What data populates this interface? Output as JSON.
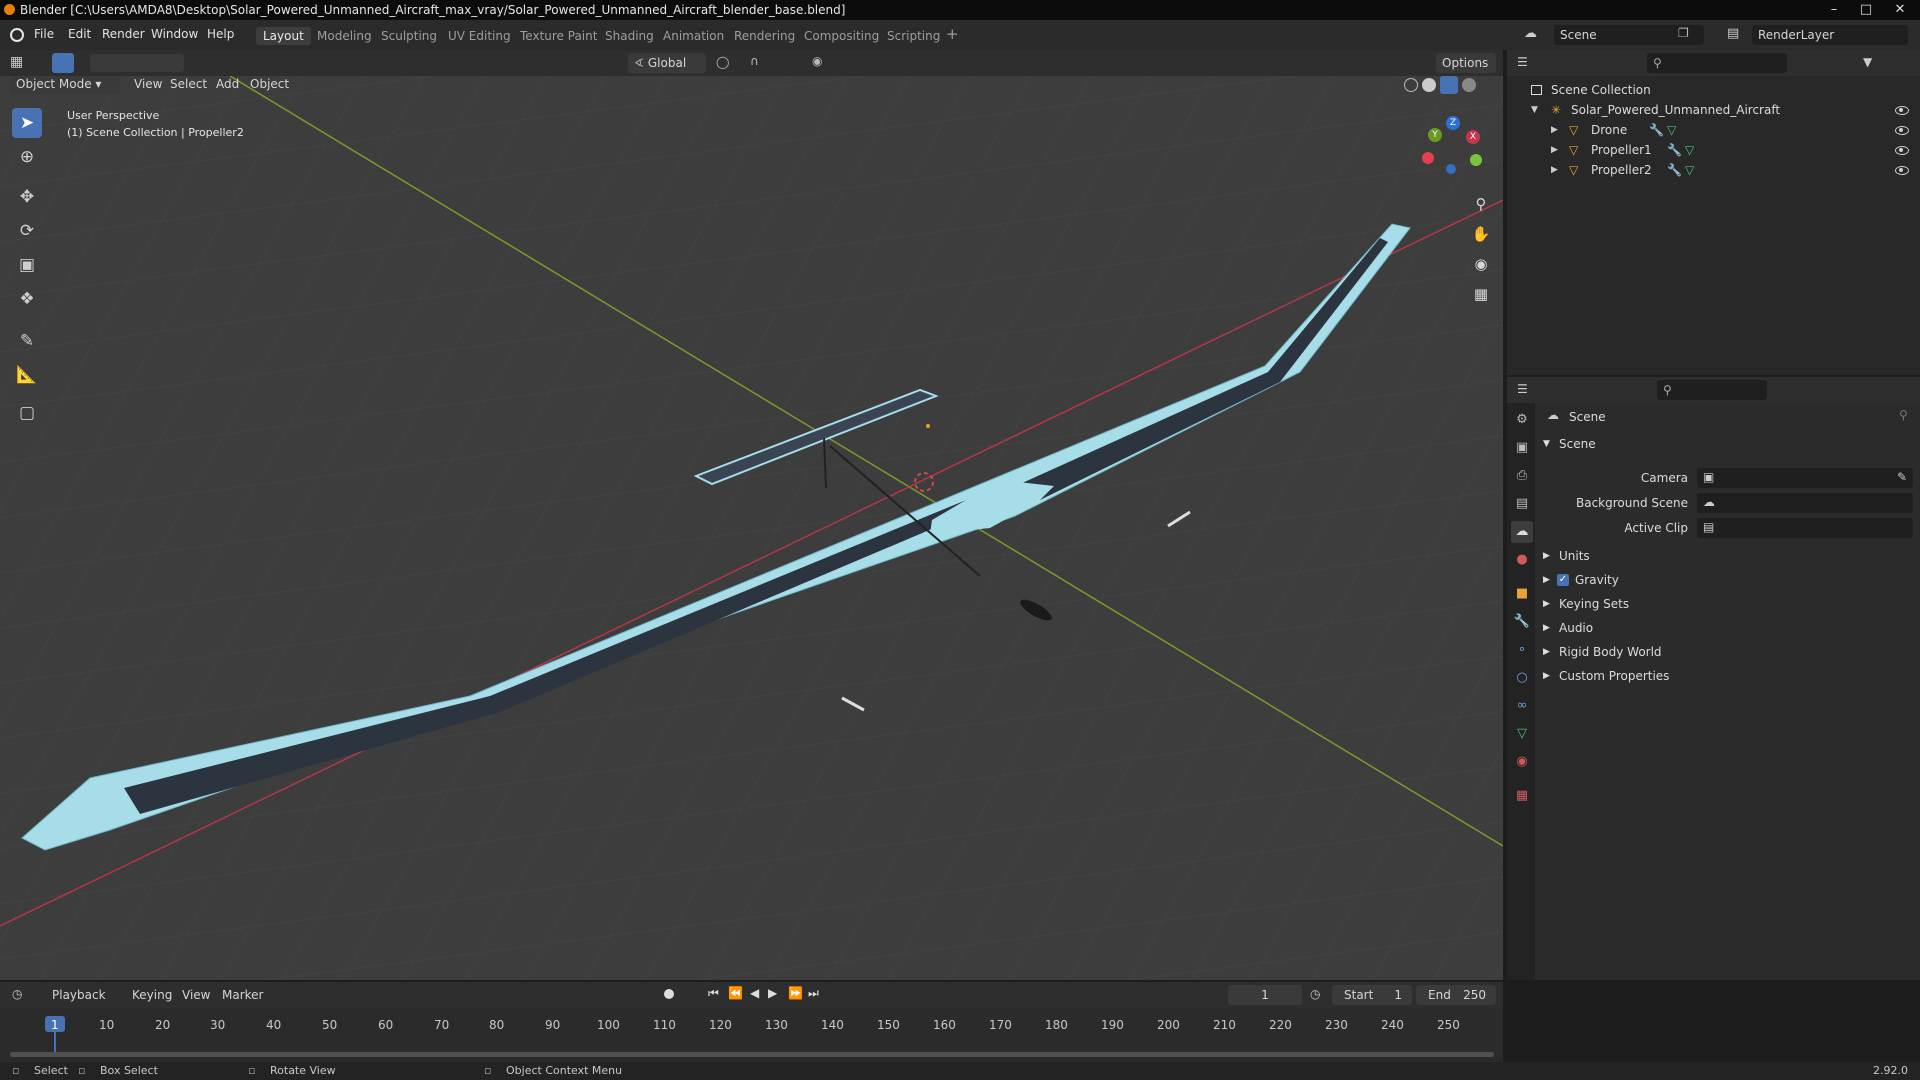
{
  "window": {
    "title": "Blender [C:\\Users\\AMDA8\\Desktop\\Solar_Powered_Unmanned_Aircraft_max_vray/Solar_Powered_Unmanned_Aircraft_blender_base.blend]"
  },
  "menubar": {
    "items": [
      "File",
      "Edit",
      "Render",
      "Window",
      "Help"
    ],
    "workspaces": [
      "Layout",
      "Modeling",
      "Sculpting",
      "UV Editing",
      "Texture Paint",
      "Shading",
      "Animation",
      "Rendering",
      "Compositing",
      "Scripting"
    ],
    "active_workspace": "Layout",
    "scene_name": "Scene",
    "view_layer": "RenderLayer"
  },
  "viewport_header": {
    "mode": "Object Mode",
    "menus": [
      "View",
      "Select",
      "Add",
      "Object"
    ],
    "transform_orientation": "Global",
    "options_label": "Options"
  },
  "viewport": {
    "perspective_label": "User Perspective",
    "collection_label": "(1) Scene Collection | Propeller2",
    "gizmo_axes": [
      "X",
      "Y",
      "Z"
    ]
  },
  "outliner": {
    "root": "Scene Collection",
    "collection": "Solar_Powered_Unmanned_Aircraft",
    "objects": [
      "Drone",
      "Propeller1",
      "Propeller2"
    ]
  },
  "properties": {
    "context": "Scene",
    "panel_title": "Scene",
    "fields": [
      {
        "label": "Camera",
        "value": ""
      },
      {
        "label": "Background Scene",
        "value": ""
      },
      {
        "label": "Active Clip",
        "value": ""
      }
    ],
    "subpanels": [
      {
        "label": "Units",
        "checkbox": false
      },
      {
        "label": "Gravity",
        "checkbox": true
      },
      {
        "label": "Keying Sets",
        "checkbox": false
      },
      {
        "label": "Audio",
        "checkbox": false
      },
      {
        "label": "Rigid Body World",
        "checkbox": false
      },
      {
        "label": "Custom Properties",
        "checkbox": false
      }
    ]
  },
  "timeline": {
    "menus": [
      "Playback",
      "Keying",
      "View",
      "Marker"
    ],
    "current_frame": "1",
    "start_label": "Start",
    "start_value": "1",
    "end_label": "End",
    "end_value": "250",
    "ruler": [
      "1",
      "10",
      "20",
      "30",
      "40",
      "50",
      "60",
      "70",
      "80",
      "90",
      "100",
      "110",
      "120",
      "130",
      "140",
      "150",
      "160",
      "170",
      "180",
      "190",
      "200",
      "210",
      "220",
      "230",
      "240",
      "250"
    ]
  },
  "statusbar": {
    "items": [
      "Select",
      "Box Select",
      "Rotate View",
      "Object Context Menu"
    ],
    "version": "2.92.0"
  },
  "colors": {
    "accent": "#4772b3",
    "wing": "#a6dde9",
    "x_axis": "#b3364b",
    "y_axis": "#7a9a2a"
  }
}
